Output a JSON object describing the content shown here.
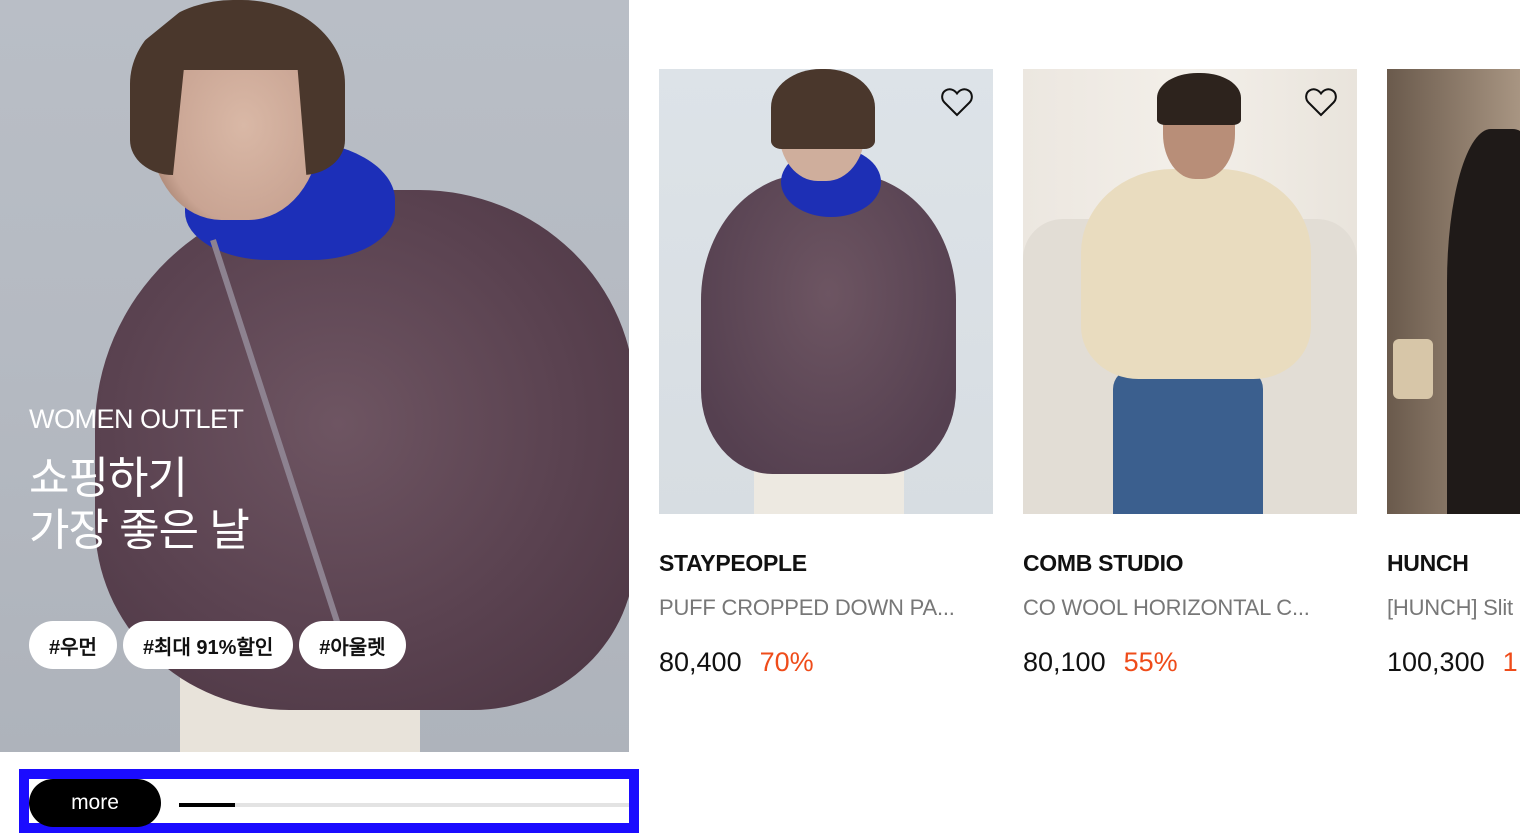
{
  "hero": {
    "eyebrow": "WOMEN OUTLET",
    "title_line1": "쇼핑하기",
    "title_line2": "가장 좋은 날",
    "tags": [
      "#우먼",
      "#최대 91%할인",
      "#아울렛"
    ]
  },
  "controls": {
    "more_label": "more",
    "progress_fraction": 0.125
  },
  "products": [
    {
      "brand": "STAYPEOPLE",
      "name": "PUFF CROPPED DOWN PA...",
      "price": "80,400",
      "discount": "70%"
    },
    {
      "brand": "COMB STUDIO",
      "name": "CO WOOL HORIZONTAL C...",
      "price": "80,100",
      "discount": "55%"
    },
    {
      "brand": "HUNCH",
      "name": "[HUNCH] Slit",
      "price": "100,300",
      "discount": "1"
    }
  ],
  "colors": {
    "discount": "#ef4c1a",
    "highlight_border": "#1b0cff",
    "button_bg": "#000000"
  },
  "icons": {
    "wishlist": "heart-outline-icon"
  }
}
